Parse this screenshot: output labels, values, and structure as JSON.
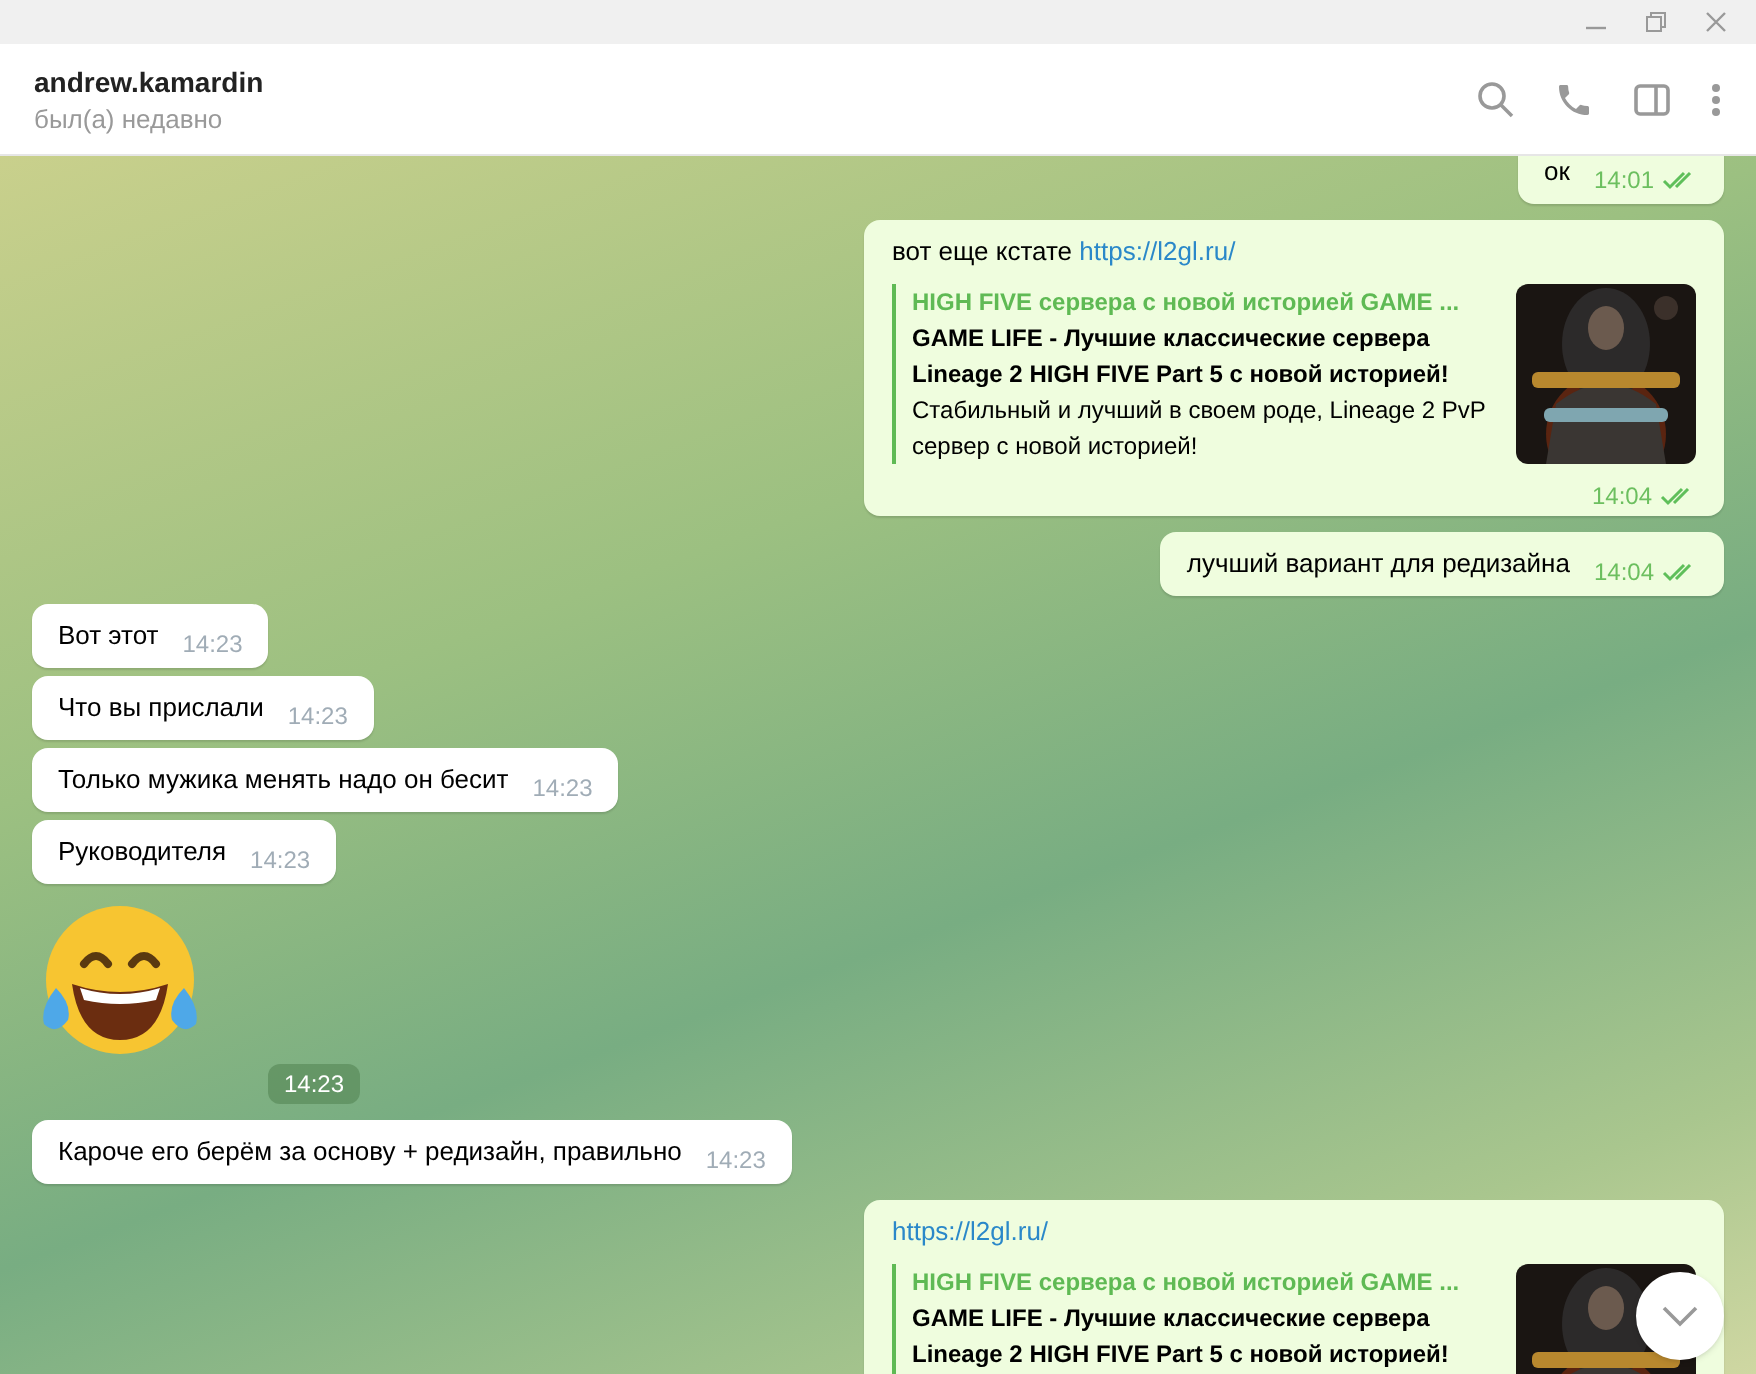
{
  "chat": {
    "name": "andrew.kamardin",
    "status": "был(а) недавно"
  },
  "messages": [
    {
      "kind": "text",
      "outgoing": true,
      "text": "ок",
      "time": "14:01",
      "read": true
    },
    {
      "kind": "link",
      "outgoing": true,
      "text": "вот еще кстате ",
      "link": "https://l2gl.ru/",
      "preview": {
        "site": "HIGH FIVE сервера с новой историей GAME ...",
        "title": "GAME LIFE - Лучшие классические сервера Lineage 2 HIGH FIVE Part 5 с новой историей!",
        "description": "Стабильный и лучший в своем роде, Lineage 2 PvP сервер с новой историей!"
      },
      "time": "14:04",
      "read": true
    },
    {
      "kind": "text",
      "outgoing": true,
      "text": "лучший вариант для редизайна",
      "time": "14:04",
      "read": true
    },
    {
      "kind": "text",
      "outgoing": false,
      "text": "Вот этот",
      "time": "14:23"
    },
    {
      "kind": "text",
      "outgoing": false,
      "text": "Что вы прислали",
      "time": "14:23"
    },
    {
      "kind": "text",
      "outgoing": false,
      "text": "Только мужика менять надо он бесит",
      "time": "14:23"
    },
    {
      "kind": "text",
      "outgoing": false,
      "text": "Руководителя",
      "time": "14:23"
    },
    {
      "kind": "sticker",
      "outgoing": false,
      "time": "14:23"
    },
    {
      "kind": "text",
      "outgoing": false,
      "text": "Кароче его берём за основу + редизайн, правильно",
      "time": "14:23"
    },
    {
      "kind": "link",
      "outgoing": true,
      "link": "https://l2gl.ru/",
      "preview": {
        "site": "HIGH FIVE сервера с новой историей GAME ...",
        "title": "GAME LIFE - Лучшие классические сервера Lineage 2 HIGH FIVE Part 5 с новой историей!"
      }
    }
  ]
}
